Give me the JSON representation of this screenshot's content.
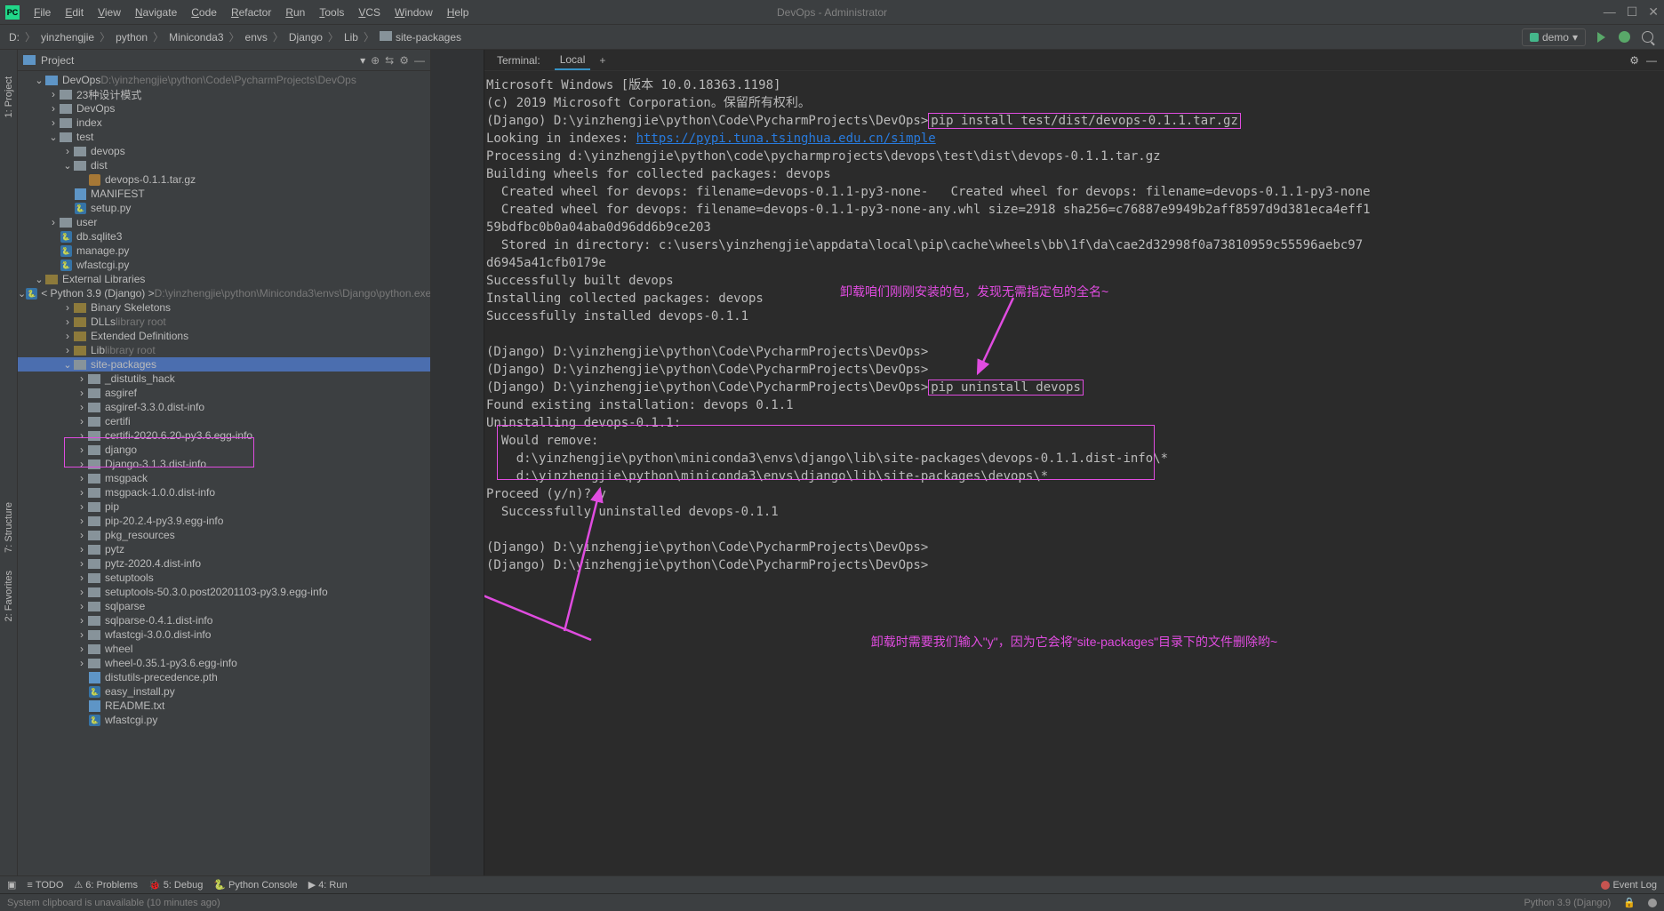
{
  "window": {
    "title": "DevOps - Administrator"
  },
  "menu": [
    "File",
    "Edit",
    "View",
    "Navigate",
    "Code",
    "Refactor",
    "Run",
    "Tools",
    "VCS",
    "Window",
    "Help"
  ],
  "breadcrumb": {
    "drive": "D:",
    "parts": [
      "yinzhengjie",
      "python",
      "Miniconda3",
      "envs",
      "Django",
      "Lib",
      "site-packages"
    ],
    "run_config": "demo"
  },
  "project": {
    "header": "Project",
    "root": "DevOps",
    "root_path": "D:\\yinzhengjie\\python\\Code\\PycharmProjects\\DevOps"
  },
  "tree": [
    {
      "depth": 0,
      "arrow": "open",
      "icon": "folder-blue",
      "label": "DevOps",
      "dim": "D:\\yinzhengjie\\python\\Code\\PycharmProjects\\DevOps"
    },
    {
      "depth": 1,
      "arrow": "closed",
      "icon": "folder",
      "label": "23种设计模式"
    },
    {
      "depth": 1,
      "arrow": "closed",
      "icon": "folder",
      "label": "DevOps"
    },
    {
      "depth": 1,
      "arrow": "closed",
      "icon": "folder",
      "label": "index"
    },
    {
      "depth": 1,
      "arrow": "open",
      "icon": "folder",
      "label": "test"
    },
    {
      "depth": 2,
      "arrow": "closed",
      "icon": "folder",
      "label": "devops"
    },
    {
      "depth": 2,
      "arrow": "open",
      "icon": "folder",
      "label": "dist"
    },
    {
      "depth": 3,
      "arrow": "none",
      "icon": "gz",
      "label": "devops-0.1.1.tar.gz"
    },
    {
      "depth": 2,
      "arrow": "none",
      "icon": "txt",
      "label": "MANIFEST"
    },
    {
      "depth": 2,
      "arrow": "none",
      "icon": "py",
      "label": "setup.py"
    },
    {
      "depth": 1,
      "arrow": "closed",
      "icon": "folder",
      "label": "user"
    },
    {
      "depth": 1,
      "arrow": "none",
      "icon": "py",
      "label": "db.sqlite3"
    },
    {
      "depth": 1,
      "arrow": "none",
      "icon": "py",
      "label": "manage.py"
    },
    {
      "depth": 1,
      "arrow": "none",
      "icon": "py",
      "label": "wfastcgi.py"
    },
    {
      "depth": 0,
      "arrow": "open",
      "icon": "lib",
      "label": "External Libraries"
    },
    {
      "depth": 1,
      "arrow": "open",
      "icon": "py",
      "label": "< Python 3.9 (Django) >",
      "dim": "D:\\yinzhengjie\\python\\Miniconda3\\envs\\Django\\python.exe"
    },
    {
      "depth": 2,
      "arrow": "closed",
      "icon": "lib",
      "label": "Binary Skeletons"
    },
    {
      "depth": 2,
      "arrow": "closed",
      "icon": "lib",
      "label": "DLLs",
      "dim": "library root"
    },
    {
      "depth": 2,
      "arrow": "closed",
      "icon": "lib",
      "label": "Extended Definitions"
    },
    {
      "depth": 2,
      "arrow": "closed",
      "icon": "lib",
      "label": "Lib",
      "dim": "library root"
    },
    {
      "depth": 2,
      "arrow": "open",
      "icon": "folder",
      "label": "site-packages",
      "selected": true
    },
    {
      "depth": 3,
      "arrow": "closed",
      "icon": "folder",
      "label": "_distutils_hack"
    },
    {
      "depth": 3,
      "arrow": "closed",
      "icon": "folder",
      "label": "asgiref"
    },
    {
      "depth": 3,
      "arrow": "closed",
      "icon": "folder",
      "label": "asgiref-3.3.0.dist-info"
    },
    {
      "depth": 3,
      "arrow": "closed",
      "icon": "folder",
      "label": "certifi"
    },
    {
      "depth": 3,
      "arrow": "closed",
      "icon": "folder",
      "label": "certifi-2020.6.20-py3.6.egg-info"
    },
    {
      "depth": 3,
      "arrow": "closed",
      "icon": "folder",
      "label": "django"
    },
    {
      "depth": 3,
      "arrow": "closed",
      "icon": "folder",
      "label": "Django-3.1.3.dist-info"
    },
    {
      "depth": 3,
      "arrow": "closed",
      "icon": "folder",
      "label": "msgpack"
    },
    {
      "depth": 3,
      "arrow": "closed",
      "icon": "folder",
      "label": "msgpack-1.0.0.dist-info"
    },
    {
      "depth": 3,
      "arrow": "closed",
      "icon": "folder",
      "label": "pip"
    },
    {
      "depth": 3,
      "arrow": "closed",
      "icon": "folder",
      "label": "pip-20.2.4-py3.9.egg-info"
    },
    {
      "depth": 3,
      "arrow": "closed",
      "icon": "folder",
      "label": "pkg_resources"
    },
    {
      "depth": 3,
      "arrow": "closed",
      "icon": "folder",
      "label": "pytz"
    },
    {
      "depth": 3,
      "arrow": "closed",
      "icon": "folder",
      "label": "pytz-2020.4.dist-info"
    },
    {
      "depth": 3,
      "arrow": "closed",
      "icon": "folder",
      "label": "setuptools"
    },
    {
      "depth": 3,
      "arrow": "closed",
      "icon": "folder",
      "label": "setuptools-50.3.0.post20201103-py3.9.egg-info"
    },
    {
      "depth": 3,
      "arrow": "closed",
      "icon": "folder",
      "label": "sqlparse"
    },
    {
      "depth": 3,
      "arrow": "closed",
      "icon": "folder",
      "label": "sqlparse-0.4.1.dist-info"
    },
    {
      "depth": 3,
      "arrow": "closed",
      "icon": "folder",
      "label": "wfastcgi-3.0.0.dist-info"
    },
    {
      "depth": 3,
      "arrow": "closed",
      "icon": "folder",
      "label": "wheel"
    },
    {
      "depth": 3,
      "arrow": "closed",
      "icon": "folder",
      "label": "wheel-0.35.1-py3.6.egg-info"
    },
    {
      "depth": 3,
      "arrow": "none",
      "icon": "txt",
      "label": "distutils-precedence.pth"
    },
    {
      "depth": 3,
      "arrow": "none",
      "icon": "py",
      "label": "easy_install.py"
    },
    {
      "depth": 3,
      "arrow": "none",
      "icon": "txt",
      "label": "README.txt"
    },
    {
      "depth": 3,
      "arrow": "none",
      "icon": "py",
      "label": "wfastcgi.py"
    }
  ],
  "sidebar_tabs": {
    "project": "1: Project",
    "structure": "7: Structure",
    "favorites": "2: Favorites"
  },
  "terminal": {
    "tab_name": "Terminal:",
    "tab_local": "Local",
    "lines": [
      {
        "t": "Microsoft Windows [版本 10.0.18363.1198]"
      },
      {
        "t": "(c) 2019 Microsoft Corporation。保留所有权利。"
      },
      {
        "parts": [
          {
            "t": "(Django) D:\\yinzhengjie\\python\\Code\\PycharmProjects\\DevOps>"
          },
          {
            "t": "pip install test/dist/devops-0.1.1.tar.gz",
            "hl": 1
          }
        ]
      },
      {
        "parts": [
          {
            "t": "Looking in indexes: "
          },
          {
            "t": "https://pypi.tuna.tsinghua.edu.cn/simple",
            "link": true
          }
        ]
      },
      {
        "t": "Processing d:\\yinzhengjie\\python\\code\\pycharmprojects\\devops\\test\\dist\\devops-0.1.1.tar.gz"
      },
      {
        "t": "Building wheels for collected packages: devops"
      },
      {
        "t": "  Created wheel for devops: filename=devops-0.1.1-py3-none-   Created wheel for devops: filename=devops-0.1.1-py3-none"
      },
      {
        "t": "  Created wheel for devops: filename=devops-0.1.1-py3-none-any.whl size=2918 sha256=c76887e9949b2aff8597d9d381eca4eff1"
      },
      {
        "t": "59bdfbc0b0a04aba0d96dd6b9ce203"
      },
      {
        "t": "  Stored in directory: c:\\users\\yinzhengjie\\appdata\\local\\pip\\cache\\wheels\\bb\\1f\\da\\cae2d32998f0a73810959c55596aebc97"
      },
      {
        "t": "d6945a41cfb0179e"
      },
      {
        "t": "Successfully built devops"
      },
      {
        "t": "Installing collected packages: devops"
      },
      {
        "t": "Successfully installed devops-0.1.1"
      },
      {
        "t": ""
      },
      {
        "t": "(Django) D:\\yinzhengjie\\python\\Code\\PycharmProjects\\DevOps>"
      },
      {
        "t": "(Django) D:\\yinzhengjie\\python\\Code\\PycharmProjects\\DevOps>"
      },
      {
        "parts": [
          {
            "t": "(Django) D:\\yinzhengjie\\python\\Code\\PycharmProjects\\DevOps>"
          },
          {
            "t": "pip uninstall devops",
            "hl": 1
          }
        ]
      },
      {
        "t": "Found existing installation: devops 0.1.1"
      },
      {
        "t": "Uninstalling devops-0.1.1:"
      },
      {
        "t": "  Would remove:",
        "boxstart": true
      },
      {
        "t": "    d:\\yinzhengjie\\python\\miniconda3\\envs\\django\\lib\\site-packages\\devops-0.1.1.dist-info\\*"
      },
      {
        "t": "    d:\\yinzhengjie\\python\\miniconda3\\envs\\django\\lib\\site-packages\\devops\\*",
        "boxend": true
      },
      {
        "t": "Proceed (y/n)? y"
      },
      {
        "t": "  Successfully uninstalled devops-0.1.1"
      },
      {
        "t": ""
      },
      {
        "t": "(Django) D:\\yinzhengjie\\python\\Code\\PycharmProjects\\DevOps>"
      },
      {
        "t": "(Django) D:\\yinzhengjie\\python\\Code\\PycharmProjects\\DevOps>"
      }
    ]
  },
  "annotations": {
    "a1": "卸载咱们刚刚安装的包，发现无需指定包的全名~",
    "a2": "卸载时需要我们输入\"y\"，因为它会将\"site-packages\"目录下的文件删除哟~"
  },
  "bottom_bar": {
    "todo": "TODO",
    "problems": "6: Problems",
    "debug": "5: Debug",
    "python_console": "Python Console",
    "run": "4: Run",
    "event_log": "Event Log"
  },
  "status_bar": {
    "msg": "System clipboard is unavailable (10 minutes ago)",
    "python": "Python 3.9 (Django)"
  }
}
